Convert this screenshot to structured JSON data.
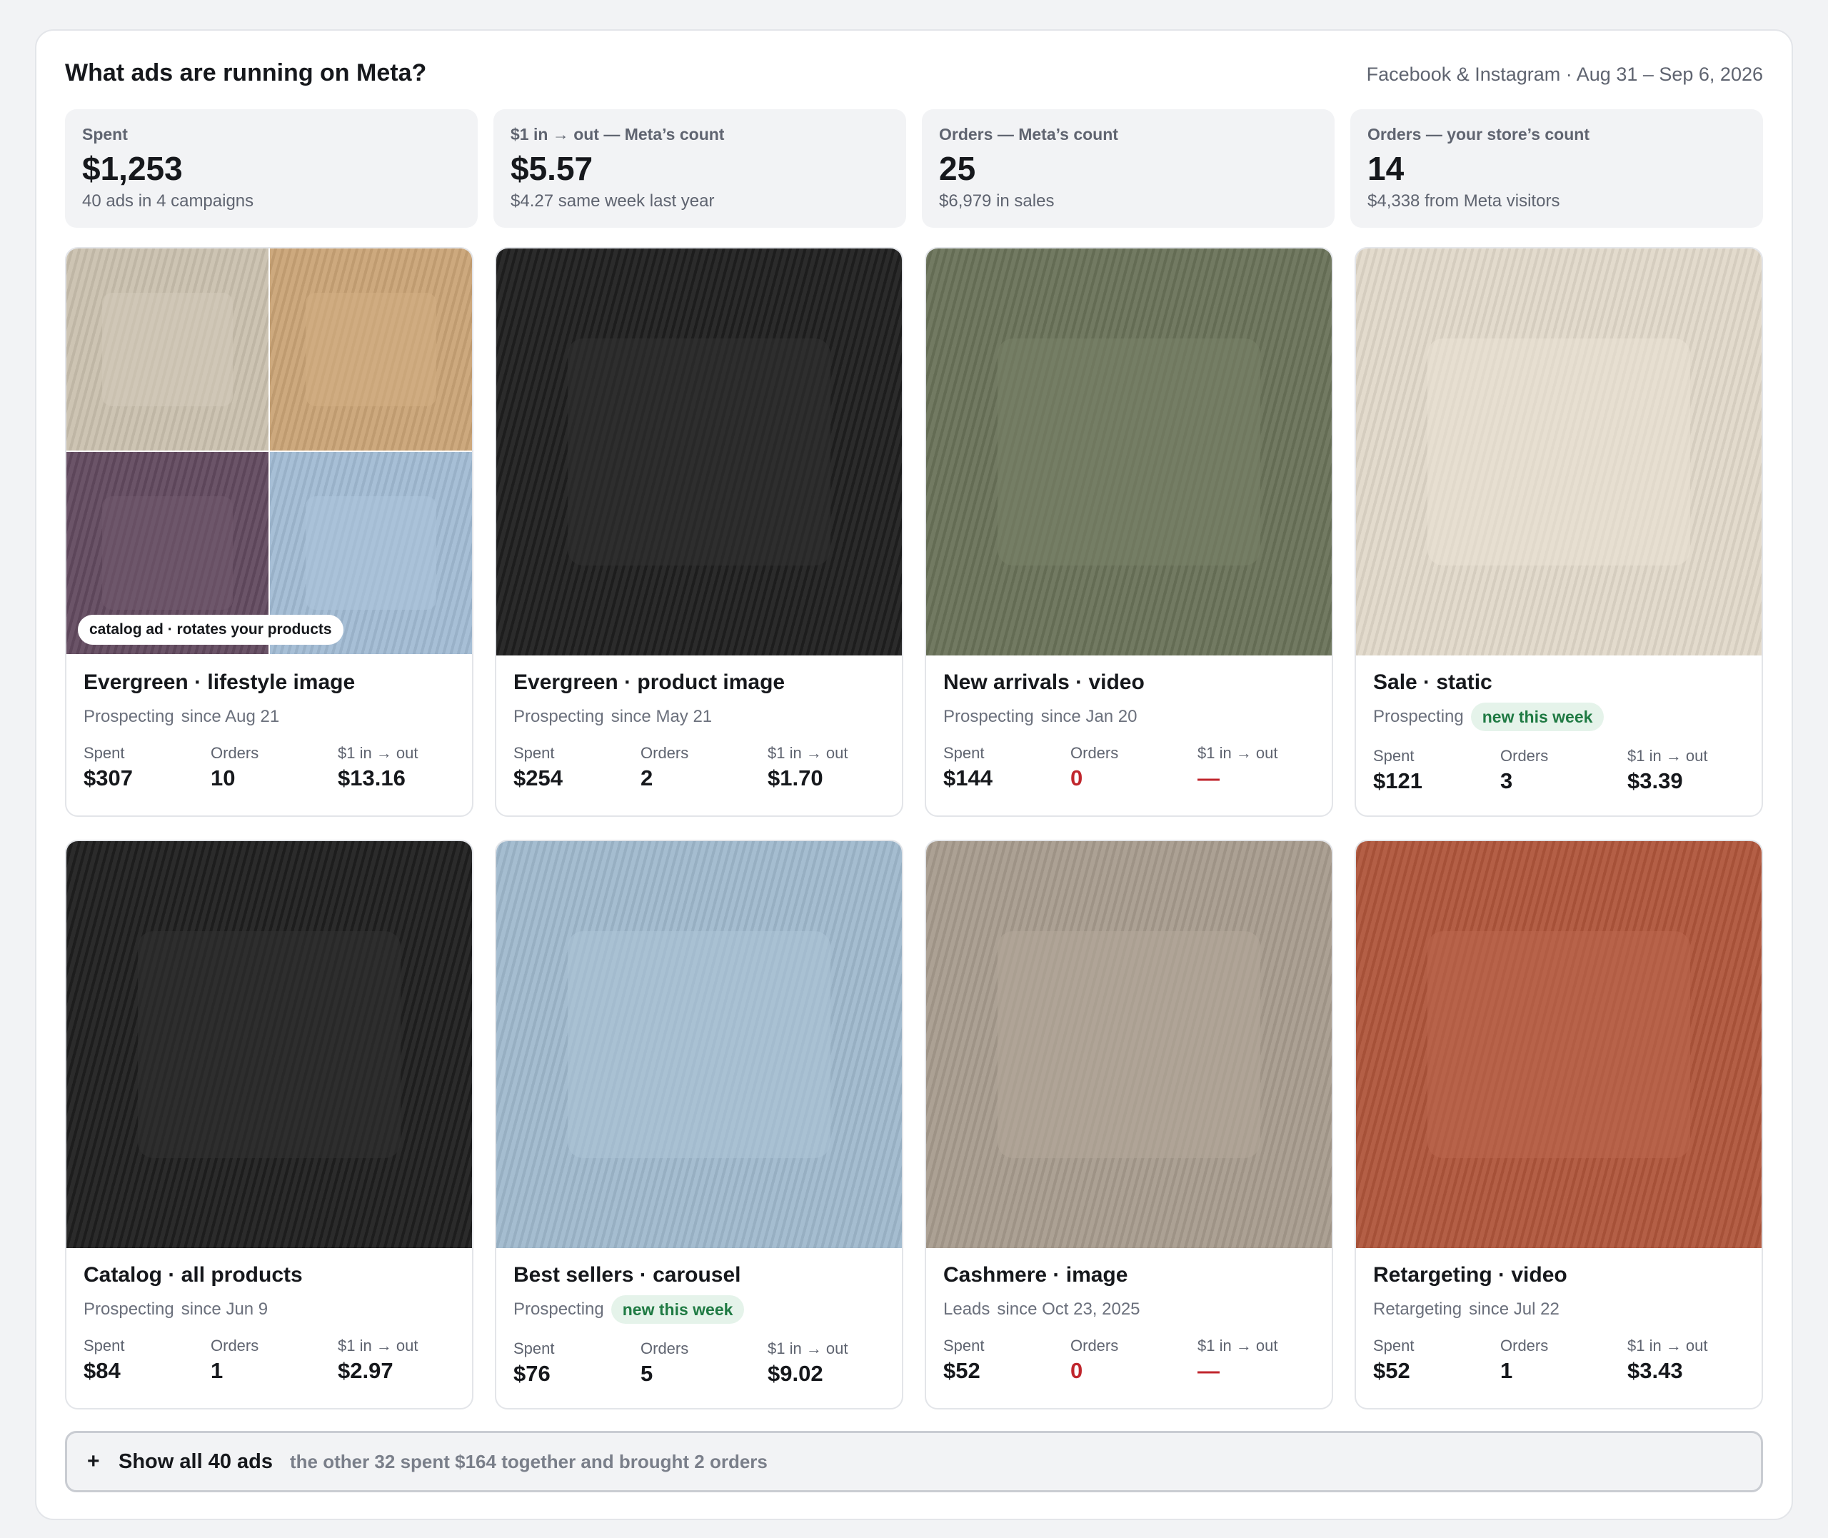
{
  "header": {
    "title": "What ads are running on Meta?",
    "subtitle": "Facebook & Instagram · Aug 31 – Sep 6, 2026"
  },
  "stats": [
    {
      "label": "Spent",
      "value": "$1,253",
      "note": "40 ads in 4 campaigns"
    },
    {
      "label": "$1 in → out — Meta’s count",
      "value": "$5.57",
      "note": "$4.27 same week last year"
    },
    {
      "label": "Orders — Meta’s count",
      "value": "25",
      "note": "$6,979 in sales"
    },
    {
      "label": "Orders — your store’s count",
      "value": "14",
      "note": "$4,338 from Meta visitors"
    }
  ],
  "metric_labels": {
    "spent": "Spent",
    "orders": "Orders",
    "roas": "$1 in → out"
  },
  "catalog_pill": "catalog ad · rotates your products",
  "ads": [
    {
      "title": "Evergreen · lifestyle image",
      "audience": "Prospecting",
      "since": "since Aug 21",
      "badge": "",
      "spent": "$307",
      "orders": "10",
      "roas": "$13.16",
      "orders_zero": false,
      "thumb": "quad",
      "colors": [
        "#cdc4b3",
        "#cda97e",
        "#6b5468",
        "#a7bfd6"
      ]
    },
    {
      "title": "Evergreen · product image",
      "audience": "Prospecting",
      "since": "since May 21",
      "badge": "",
      "spent": "$254",
      "orders": "2",
      "roas": "$1.70",
      "orders_zero": false,
      "thumb": "single",
      "colors": [
        "#2b2b2b"
      ]
    },
    {
      "title": "New arrivals · video",
      "audience": "Prospecting",
      "since": "since Jan 20",
      "badge": "",
      "spent": "$144",
      "orders": "0",
      "roas": "—",
      "orders_zero": true,
      "thumb": "single",
      "colors": [
        "#727a62"
      ]
    },
    {
      "title": "Sale · static",
      "audience": "Prospecting",
      "since": "",
      "badge": "new this week",
      "spent": "$121",
      "orders": "3",
      "roas": "$3.39",
      "orders_zero": false,
      "thumb": "single",
      "colors": [
        "#e3dbcd"
      ]
    },
    {
      "title": "Catalog · all products",
      "audience": "Prospecting",
      "since": "since Jun 9",
      "badge": "",
      "spent": "$84",
      "orders": "1",
      "roas": "$2.97",
      "orders_zero": false,
      "thumb": "single",
      "colors": [
        "#2b2b2b"
      ]
    },
    {
      "title": "Best sellers · carousel",
      "audience": "Prospecting",
      "since": "",
      "badge": "new this week",
      "spent": "$76",
      "orders": "5",
      "roas": "$9.02",
      "orders_zero": false,
      "thumb": "single",
      "colors": [
        "#a5bdd0"
      ]
    },
    {
      "title": "Cashmere · image",
      "audience": "Leads",
      "since": "since Oct 23, 2025",
      "badge": "",
      "spent": "$52",
      "orders": "0",
      "roas": "—",
      "orders_zero": true,
      "thumb": "single",
      "colors": [
        "#aca194"
      ]
    },
    {
      "title": "Retargeting · video",
      "audience": "Retargeting",
      "since": "since Jul 22",
      "badge": "",
      "spent": "$52",
      "orders": "1",
      "roas": "$3.43",
      "orders_zero": false,
      "thumb": "single",
      "colors": [
        "#b45f46"
      ]
    }
  ],
  "show_all": {
    "icon": "plus-icon",
    "label": "Show all 40 ads",
    "note": "the other 32 spent $164 together and brought 2 orders"
  }
}
